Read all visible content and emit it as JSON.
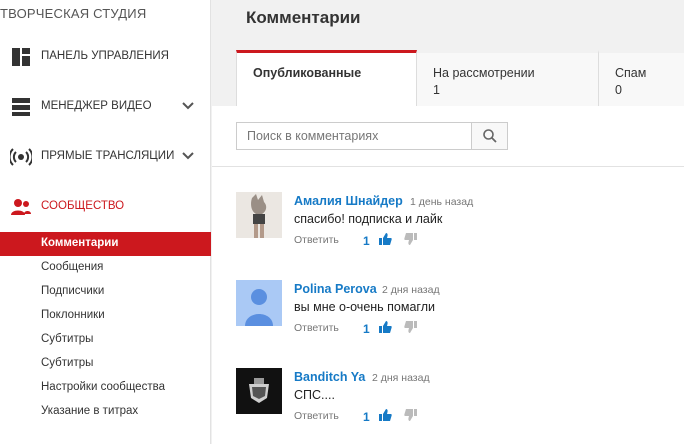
{
  "sidebar": {
    "studio_title": "ТВОРЧЕСКАЯ СТУДИЯ",
    "nav": [
      {
        "label": "ПАНЕЛЬ УПРАВЛЕНИЯ",
        "icon": "dashboard-icon"
      },
      {
        "label": "МЕНЕДЖЕР ВИДЕО",
        "icon": "video-manager-icon"
      },
      {
        "label": "ПРЯМЫЕ ТРАНСЛЯЦИИ",
        "icon": "live-broadcast-icon"
      },
      {
        "label": "СООБЩЕСТВО",
        "icon": "community-icon"
      }
    ],
    "community_items": [
      "Комментарии",
      "Сообщения",
      "Подписчики",
      "Поклонники",
      "Субтитры",
      "Субтитры",
      "Настройки сообщества",
      "Указание в титрах"
    ]
  },
  "main": {
    "title": "Комментарии",
    "tabs": [
      {
        "label": "Опубликованные",
        "count": ""
      },
      {
        "label": "На рассмотрении",
        "count": "1"
      },
      {
        "label": "Спам",
        "count": "0"
      }
    ],
    "search": {
      "placeholder": "Поиск в комментариях",
      "value": ""
    },
    "comments": [
      {
        "author": "Амалия Шнайдер",
        "time": "1 день назад",
        "text": "спасибо! подписка и лайк",
        "reply": "Ответить",
        "likes": "1"
      },
      {
        "author": "Polina Perova",
        "time": "2 дня назад",
        "text": "вы мне о-очень помагли",
        "reply": "Ответить",
        "likes": "1"
      },
      {
        "author": "Banditch Ya",
        "time": "2 дня назад",
        "text": "СПС....",
        "reply": "Ответить",
        "likes": "1"
      }
    ]
  },
  "colors": {
    "accent": "#cc181e",
    "link": "#167ac6"
  }
}
